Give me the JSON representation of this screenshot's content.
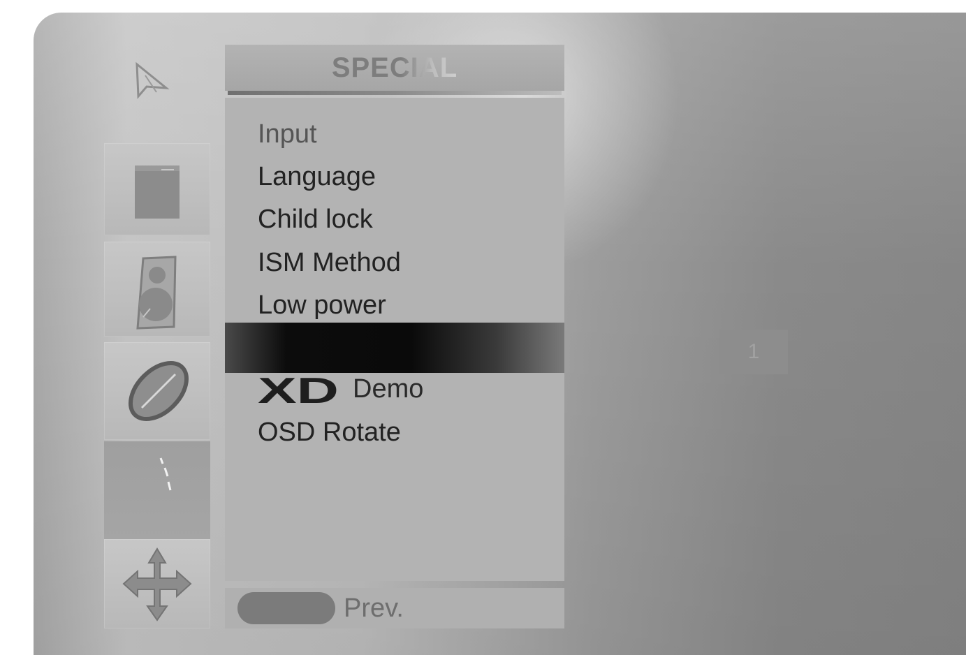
{
  "menu": {
    "title": "SPECIAL",
    "items": [
      {
        "label": "Input"
      },
      {
        "label": "Language"
      },
      {
        "label": "Child lock"
      },
      {
        "label": "ISM Method"
      },
      {
        "label": "Low power"
      },
      {
        "label": "",
        "highlighted": true
      },
      {
        "label": "Demo",
        "logo": "XD"
      },
      {
        "label": "OSD Rotate"
      }
    ]
  },
  "categories": [
    {
      "icon": "picture-icon"
    },
    {
      "icon": "sound-icon"
    },
    {
      "icon": "time-icon"
    },
    {
      "icon": "special-icon"
    }
  ],
  "footer": {
    "prev_label": "Prev."
  },
  "value_display": {
    "text": "1"
  }
}
